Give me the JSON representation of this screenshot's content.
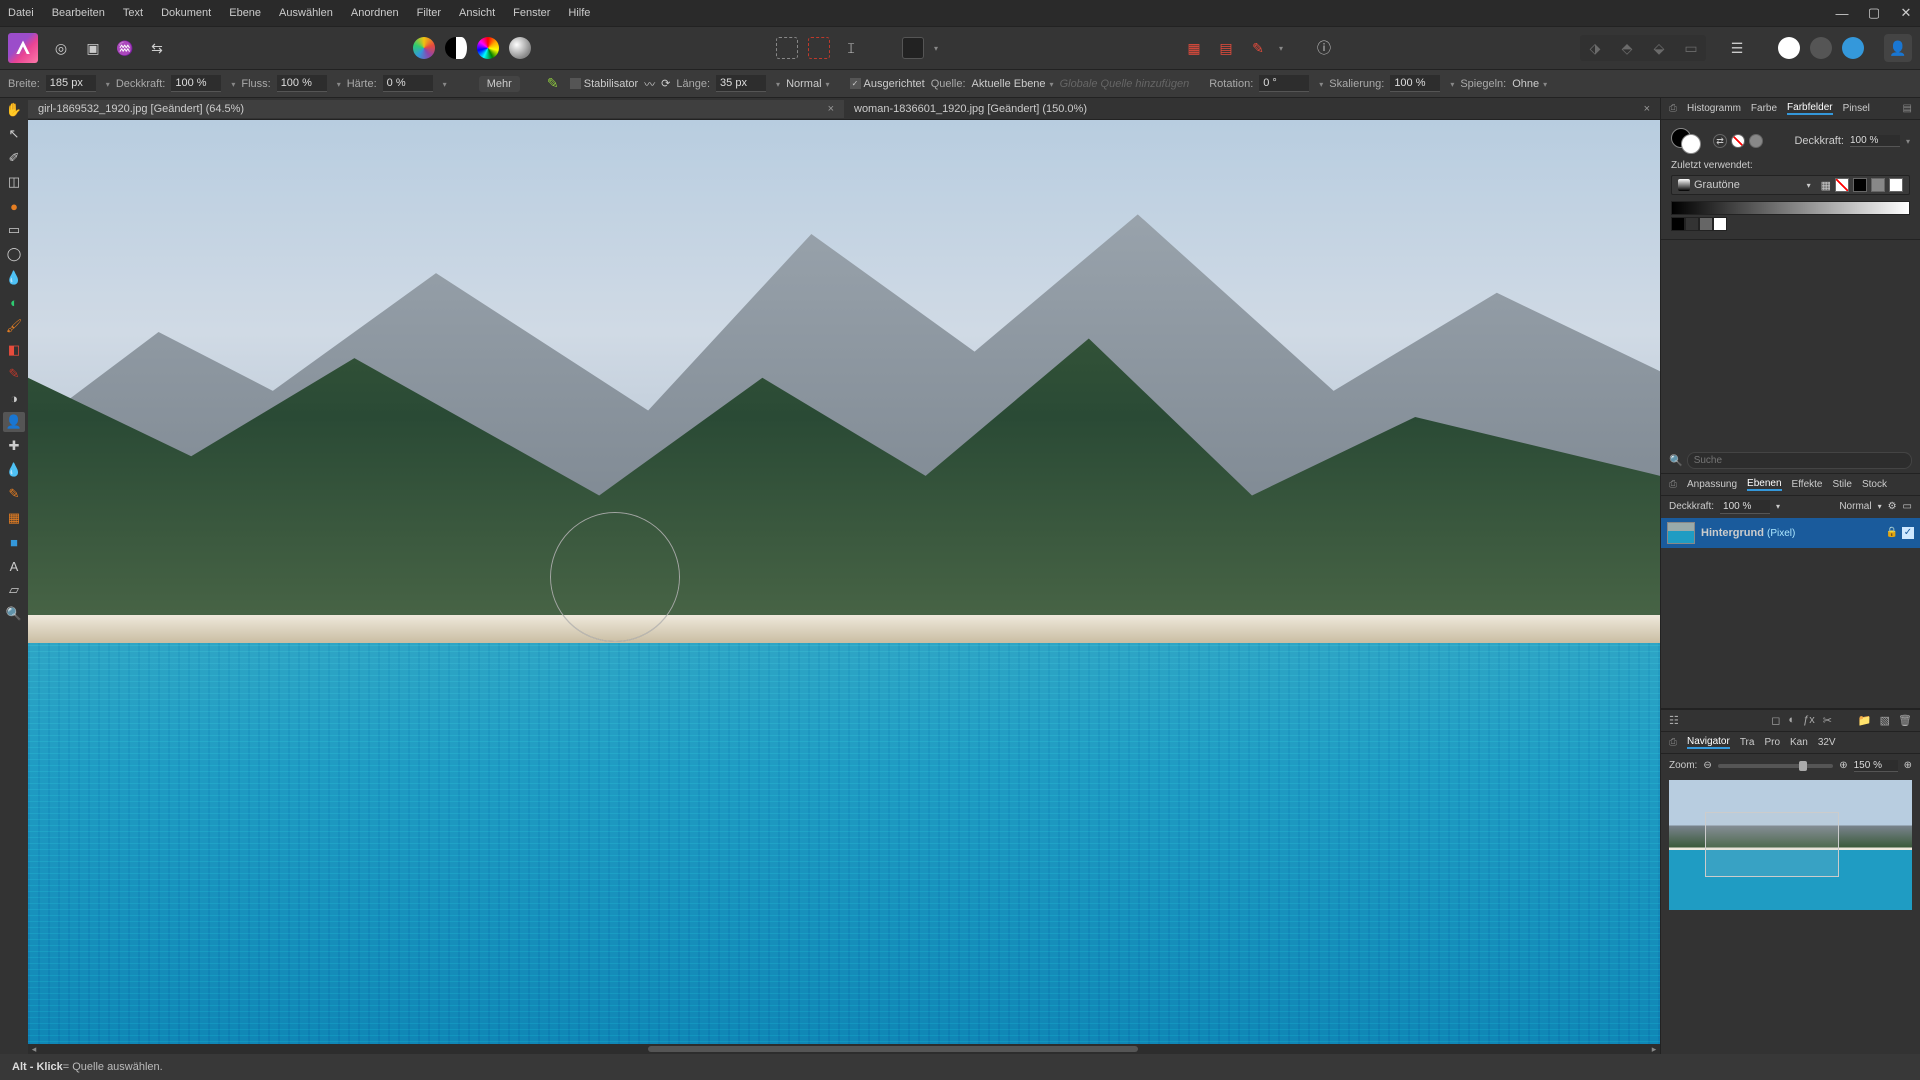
{
  "menu": {
    "file": "Datei",
    "edit": "Bearbeiten",
    "text": "Text",
    "document": "Dokument",
    "layer": "Ebene",
    "select": "Auswählen",
    "arrange": "Anordnen",
    "filter": "Filter",
    "view": "Ansicht",
    "window": "Fenster",
    "help": "Hilfe"
  },
  "options": {
    "width_label": "Breite:",
    "width_value": "185 px",
    "opacity_label": "Deckkraft:",
    "opacity_value": "100 %",
    "flow_label": "Fluss:",
    "flow_value": "100 %",
    "hardness_label": "Härte:",
    "hardness_value": "0 %",
    "more": "Mehr",
    "stabilizer": "Stabilisator",
    "length_label": "Länge:",
    "length_value": "35 px",
    "mode": "Normal",
    "aligned": "Ausgerichtet",
    "source_label": "Quelle:",
    "source_value": "Aktuelle Ebene",
    "global_source_placeholder": "Globale Quelle hinzufügen",
    "rotation_label": "Rotation:",
    "rotation_value": "0 °",
    "scale_label": "Skalierung:",
    "scale_value": "100 %",
    "mirror_label": "Spiegeln:",
    "mirror_value": "Ohne"
  },
  "tabs": [
    {
      "title": "girl-1869532_1920.jpg [Geändert] (64.5%)",
      "active": true
    },
    {
      "title": "woman-1836601_1920.jpg [Geändert] (150.0%)",
      "active": false
    }
  ],
  "right": {
    "top_tabs": [
      "Histogramm",
      "Farbe",
      "Farbfelder",
      "Pinsel"
    ],
    "top_active": "Farbfelder",
    "color_opacity_label": "Deckkraft:",
    "color_opacity_value": "100 %",
    "recent_label": "Zuletzt verwendet:",
    "swatch_set": "Grautöne",
    "search_placeholder": "Suche",
    "layer_tabs": [
      "Anpassung",
      "Ebenen",
      "Effekte",
      "Stile",
      "Stock"
    ],
    "layer_active": "Ebenen",
    "layer_opacity_label": "Deckkraft:",
    "layer_opacity_value": "100 %",
    "blend_mode": "Normal",
    "layer_name": "Hintergrund",
    "layer_type": "(Pixel)",
    "nav_tabs": [
      "Navigator",
      "Tra",
      "Pro",
      "Kan",
      "32V"
    ],
    "nav_active": "Navigator",
    "zoom_label": "Zoom:",
    "zoom_value": "150 %"
  },
  "statusbar": {
    "hint_bold": "Alt - Klick",
    "hint_rest": " = Quelle auswählen."
  }
}
